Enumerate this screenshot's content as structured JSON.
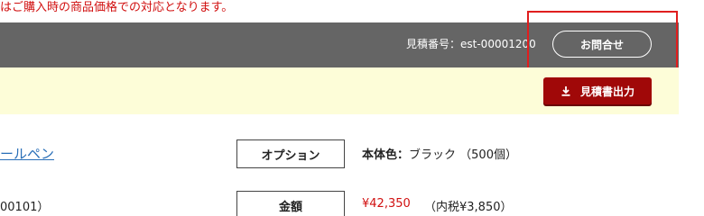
{
  "notice": {
    "text": "はご購入時の商品価格での対応となります。"
  },
  "header": {
    "quote_number_label": "見積番号：",
    "quote_number_value": "est-00001200",
    "contact_button_label": "お問合せ"
  },
  "actions": {
    "export_button_label": "見積書出力",
    "export_icon": "download-icon"
  },
  "product": {
    "name_partial": "ールペン",
    "code_partial": "00101）",
    "option_label": "オプション",
    "option_key": "本体色：",
    "option_value": "ブラック （500個）",
    "amount_label": "金額",
    "price": "¥42,350",
    "tax_note": "（内税¥3,850）"
  },
  "colors": {
    "header_bar": "#656565",
    "yellow_band": "#fdfdd8",
    "export_button": "#a00808",
    "price_red": "#d11010",
    "highlight_border": "#e01e1e",
    "link_blue": "#2a6fb8"
  }
}
